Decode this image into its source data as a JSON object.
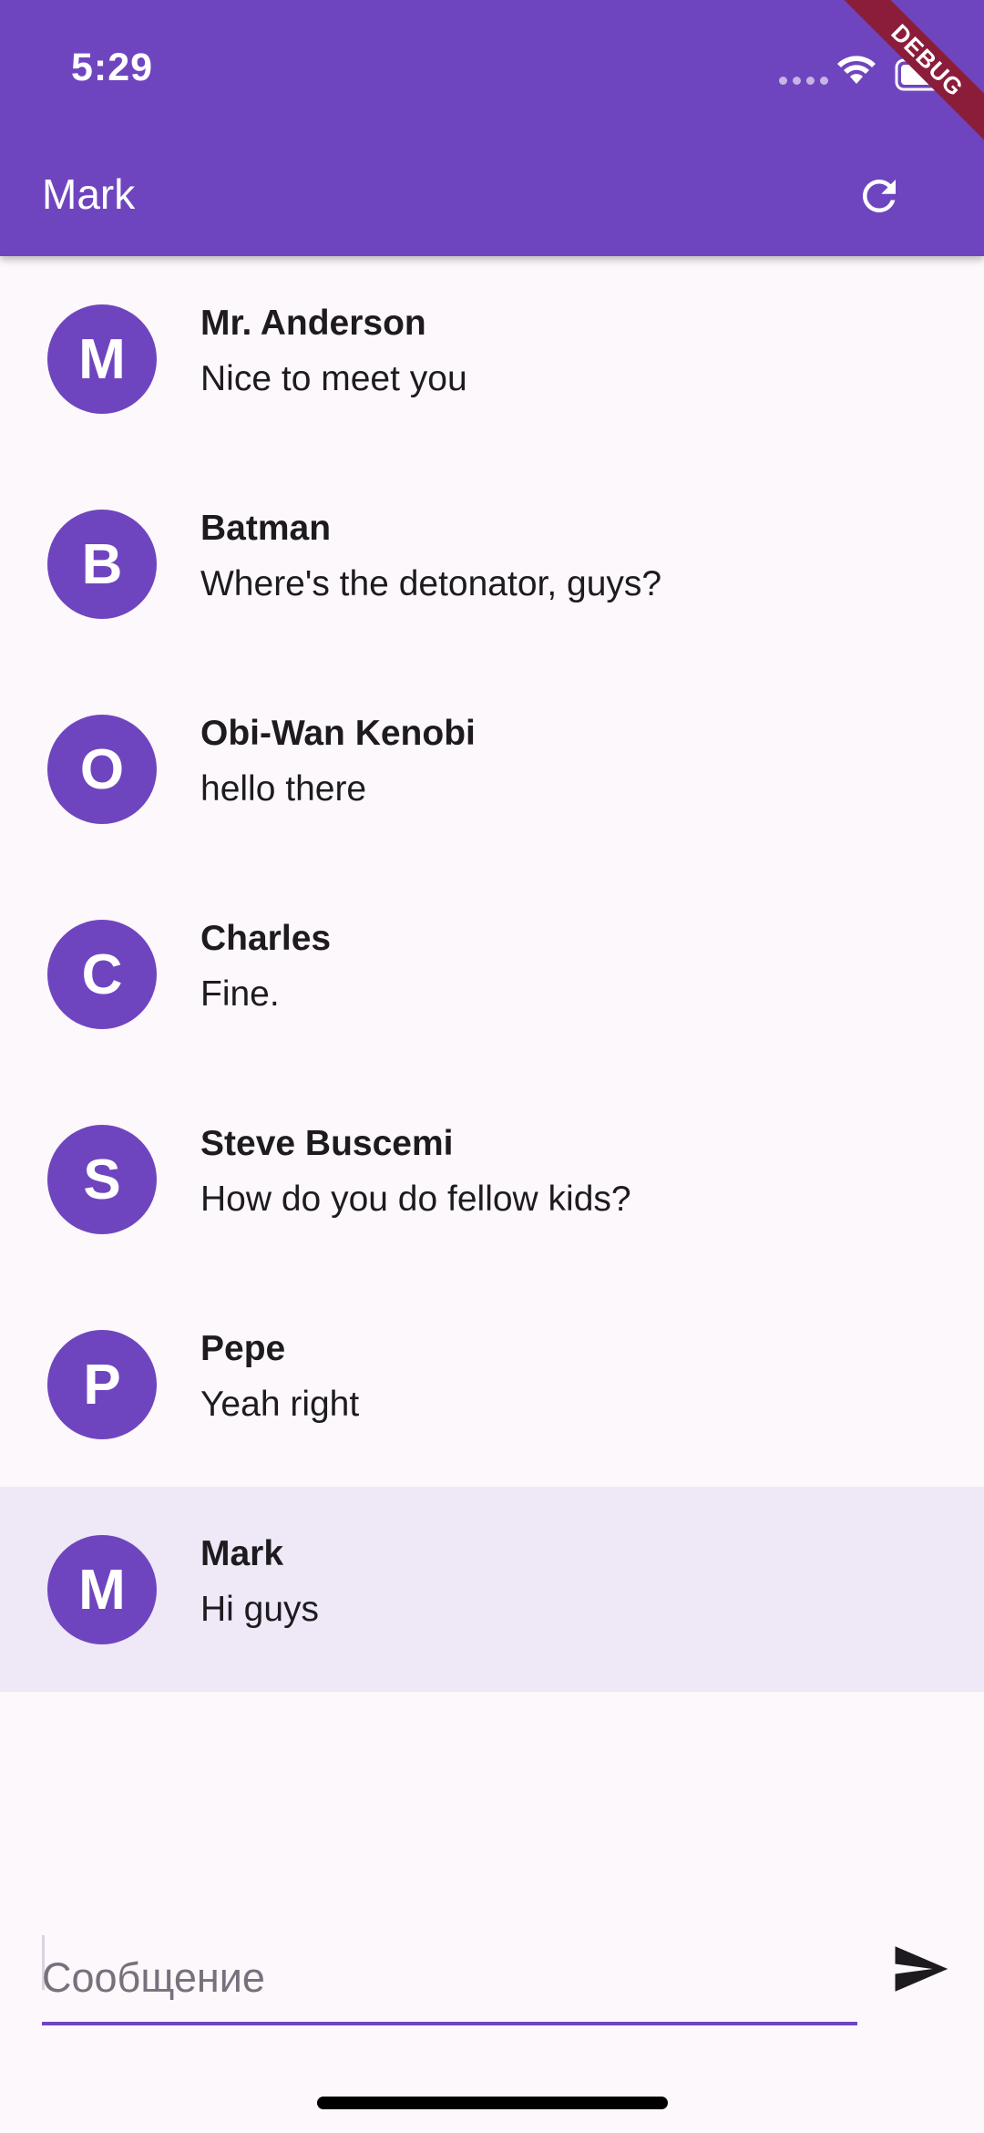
{
  "status_bar": {
    "time": "5:29"
  },
  "debug_banner": {
    "label": "DEBUG"
  },
  "appbar": {
    "title": "Mark",
    "refresh_icon": "refresh-icon"
  },
  "chats": [
    {
      "initial": "M",
      "name": "Mr. Anderson",
      "message": "Nice to meet you",
      "selected": false
    },
    {
      "initial": "B",
      "name": "Batman",
      "message": "Where's the detonator, guys?",
      "selected": false
    },
    {
      "initial": "O",
      "name": "Obi-Wan Kenobi",
      "message": "hello there",
      "selected": false
    },
    {
      "initial": "C",
      "name": "Charles",
      "message": "Fine.",
      "selected": false
    },
    {
      "initial": "S",
      "name": "Steve Buscemi",
      "message": "How do you do fellow kids?",
      "selected": false
    },
    {
      "initial": "P",
      "name": "Pepe",
      "message": "Yeah right",
      "selected": false
    },
    {
      "initial": "M",
      "name": "Mark",
      "message": "Hi guys",
      "selected": true
    }
  ],
  "composer": {
    "placeholder": "Сообщение",
    "value": "",
    "send_icon": "send-icon"
  },
  "colors": {
    "primary": "#6f45bf",
    "selected_row": "#eee8f7",
    "background": "#fdf8fb",
    "debug": "#8b1d3a"
  }
}
